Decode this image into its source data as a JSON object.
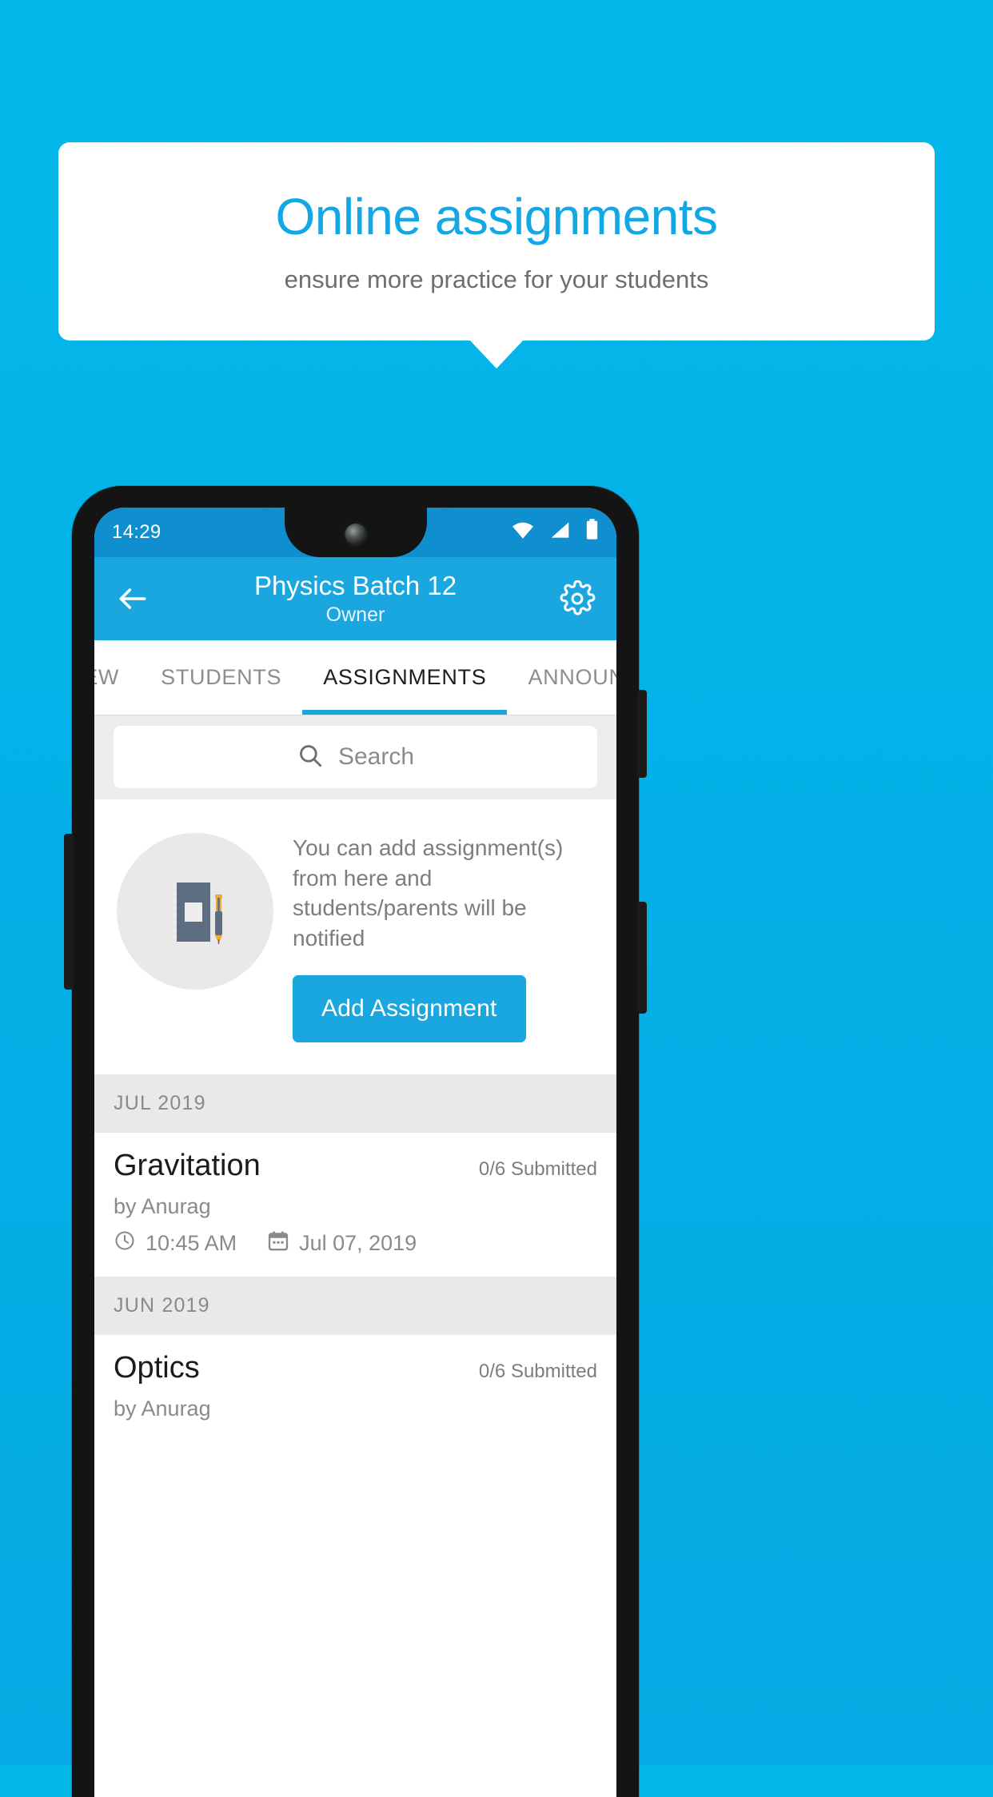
{
  "promo": {
    "title": "Online assignments",
    "subtitle": "ensure more practice for your students",
    "title_color": "#12a7e5",
    "background_color": "#04b2e8"
  },
  "phone": {
    "status_bar": {
      "time": "14:29",
      "icons": [
        "wifi-icon",
        "cellular-signal-icon",
        "battery-icon"
      ],
      "background_color": "#0f8fd0"
    },
    "app_bar": {
      "back_icon": "back-arrow-icon",
      "title": "Physics Batch 12",
      "subtitle": "Owner",
      "settings_icon": "gear-icon",
      "background_color": "#1aa7e0"
    },
    "tabs": [
      {
        "label": "IEW",
        "active": false
      },
      {
        "label": "STUDENTS",
        "active": false
      },
      {
        "label": "ASSIGNMENTS",
        "active": true
      },
      {
        "label": "ANNOUNCEMEN",
        "active": false
      }
    ],
    "search": {
      "icon": "search-icon",
      "placeholder": "Search",
      "value": ""
    },
    "empty_state": {
      "illustration": "notebook-and-pen-icon",
      "text": "You can add assignment(s) from here and students/parents will be notified",
      "button_label": "Add Assignment",
      "button_color": "#1aa7e0"
    },
    "groups": [
      {
        "month": "JUL 2019",
        "items": [
          {
            "title": "Gravitation",
            "submitted": "0/6 Submitted",
            "author": "by Anurag",
            "time_icon": "clock-icon",
            "time": "10:45 AM",
            "date_icon": "calendar-icon",
            "date": "Jul 07, 2019"
          }
        ]
      },
      {
        "month": "JUN 2019",
        "items": [
          {
            "title": "Optics",
            "submitted": "0/6 Submitted",
            "author": "by Anurag",
            "time_icon": "clock-icon",
            "time": "",
            "date_icon": "calendar-icon",
            "date": ""
          }
        ]
      }
    ]
  }
}
